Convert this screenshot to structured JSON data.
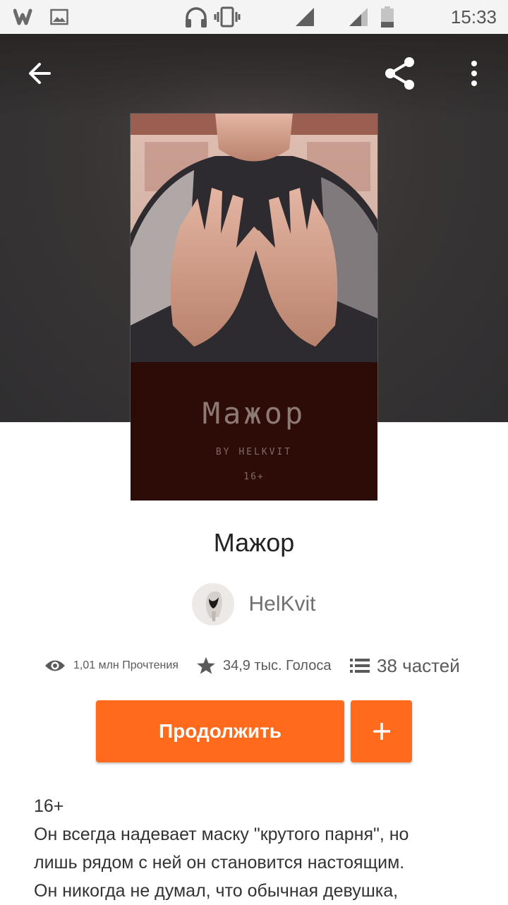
{
  "status_bar": {
    "time": "15:33",
    "icons": [
      "wattpad-notification-icon",
      "image-notification-icon",
      "headphones-icon",
      "vibrate-icon",
      "signal-icon",
      "signal-icon-2",
      "battery-icon"
    ]
  },
  "header": {
    "back_icon": "arrow-left-icon",
    "share_icon": "share-icon",
    "more_icon": "more-vertical-icon"
  },
  "cover": {
    "title": "Мажор",
    "byline": "BY HELKVIT",
    "age": "16+"
  },
  "story": {
    "title": "Мажор",
    "author": "HelKvit"
  },
  "stats": {
    "reads": "1,01 млн Прочтения",
    "votes": "34,9 тыс. Голоса",
    "parts": "38 частей"
  },
  "actions": {
    "continue_label": "Продолжить",
    "add_icon": "plus-icon"
  },
  "description": {
    "lines": [
      "16+",
      "Он всегда надевает маску \"крутого парня\", но",
      "лишь рядом с ней он становится настоящим.",
      "Он никогда не думал, что обычная девушка,"
    ]
  },
  "colors": {
    "accent": "#ff6a1c",
    "header_bg": "#393535",
    "cover_bg": "#2d0b07"
  }
}
